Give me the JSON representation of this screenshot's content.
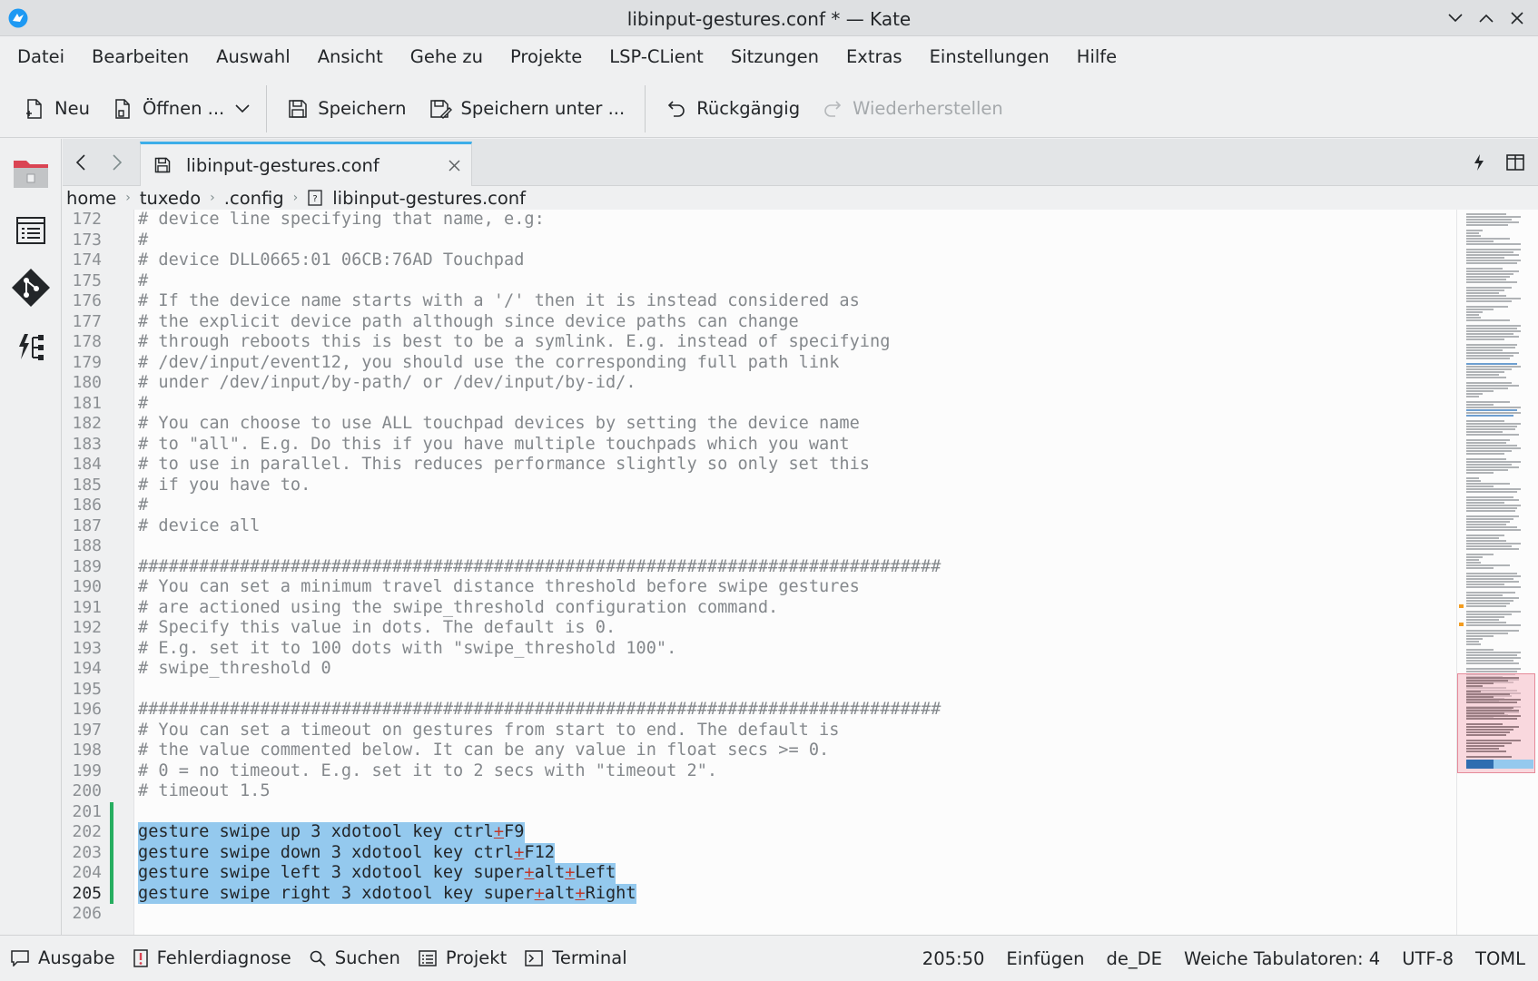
{
  "titlebar": {
    "title": "libinput-gestures.conf * — Kate"
  },
  "menubar": {
    "items": [
      "Datei",
      "Bearbeiten",
      "Auswahl",
      "Ansicht",
      "Gehe zu",
      "Projekte",
      "LSP-CLient",
      "Sitzungen",
      "Extras",
      "Einstellungen",
      "Hilfe"
    ]
  },
  "toolbar": {
    "new_label": "Neu",
    "open_label": "Öffnen ...",
    "save_label": "Speichern",
    "save_as_label": "Speichern unter ...",
    "undo_label": "Rückgängig",
    "redo_label": "Wiederherstellen"
  },
  "tab": {
    "filename": "libinput-gestures.conf"
  },
  "breadcrumb": [
    "home",
    "tuxedo",
    ".config",
    "libinput-gestures.conf"
  ],
  "editor": {
    "current_line": 205,
    "lines": [
      {
        "n": "172",
        "text": "# device line specifying that name, e.g:"
      },
      {
        "n": "173",
        "text": "#"
      },
      {
        "n": "174",
        "text": "# device DLL0665:01 06CB:76AD Touchpad"
      },
      {
        "n": "175",
        "text": "#"
      },
      {
        "n": "176",
        "text": "# If the device name starts with a '/' then it is instead considered as"
      },
      {
        "n": "177",
        "text": "# the explicit device path although since device paths can change"
      },
      {
        "n": "178",
        "text": "# through reboots this is best to be a symlink. E.g. instead of specifying"
      },
      {
        "n": "179",
        "text": "# /dev/input/event12, you should use the corresponding full path link"
      },
      {
        "n": "180",
        "text": "# under /dev/input/by-path/ or /dev/input/by-id/."
      },
      {
        "n": "181",
        "text": "#"
      },
      {
        "n": "182",
        "text": "# You can choose to use ALL touchpad devices by setting the device name"
      },
      {
        "n": "183",
        "text": "# to \"all\". E.g. Do this if you have multiple touchpads which you want"
      },
      {
        "n": "184",
        "text": "# to use in parallel. This reduces performance slightly so only set this"
      },
      {
        "n": "185",
        "text": "# if you have to."
      },
      {
        "n": "186",
        "text": "#"
      },
      {
        "n": "187",
        "text": "# device all"
      },
      {
        "n": "188",
        "text": ""
      },
      {
        "n": "189",
        "text": "###############################################################################"
      },
      {
        "n": "190",
        "text": "# You can set a minimum travel distance threshold before swipe gestures"
      },
      {
        "n": "191",
        "text": "# are actioned using the swipe_threshold configuration command."
      },
      {
        "n": "192",
        "text": "# Specify this value in dots. The default is 0."
      },
      {
        "n": "193",
        "text": "# E.g. set it to 100 dots with \"swipe_threshold 100\"."
      },
      {
        "n": "194",
        "text": "# swipe_threshold 0"
      },
      {
        "n": "195",
        "text": ""
      },
      {
        "n": "196",
        "text": "###############################################################################"
      },
      {
        "n": "197",
        "text": "# You can set a timeout on gestures from start to end. The default is"
      },
      {
        "n": "198",
        "text": "# the value commented below. It can be any value in float secs >= 0."
      },
      {
        "n": "199",
        "text": "# 0 = no timeout. E.g. set it to 2 secs with \"timeout 2\"."
      },
      {
        "n": "200",
        "text": "# timeout 1.5"
      },
      {
        "n": "201",
        "text": ""
      },
      {
        "n": "202",
        "text": "gesture swipe up 3 xdotool key ctrl+F9",
        "sel": true
      },
      {
        "n": "203",
        "text": "gesture swipe down 3 xdotool key ctrl+F12",
        "sel": true
      },
      {
        "n": "204",
        "text": "gesture swipe left 3 xdotool key super+alt+Left",
        "sel": true
      },
      {
        "n": "205",
        "text": "gesture swipe right 3 xdotool key super+alt+Right",
        "sel": true
      },
      {
        "n": "206",
        "text": ""
      }
    ]
  },
  "statusbar": {
    "output": "Ausgabe",
    "diagnostics": "Fehlerdiagnose",
    "search": "Suchen",
    "project": "Projekt",
    "terminal": "Terminal",
    "cursor": "205:50",
    "mode": "Einfügen",
    "language": "de_DE",
    "indent": "Weiche Tabulatoren: 4",
    "encoding": "UTF-8",
    "filetype": "TOML"
  },
  "colors": {
    "accent": "#3daee9",
    "selection": "#94c9ee",
    "modified": "#27ae60"
  }
}
